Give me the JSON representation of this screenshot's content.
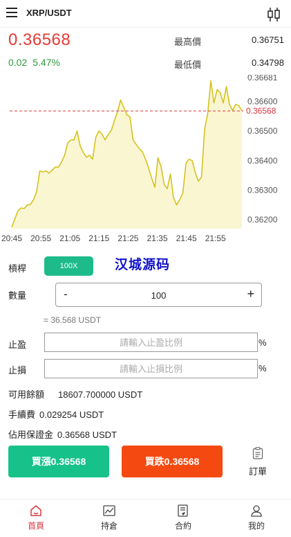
{
  "header": {
    "title": "XRP/USDT"
  },
  "price": {
    "last": "0.36568",
    "change": "0.02",
    "change_pct": "5.47%"
  },
  "high": {
    "label": "最高價",
    "value": "0.36751"
  },
  "low": {
    "label": "最低價",
    "value": "0.34798"
  },
  "chart_data": {
    "type": "area",
    "x_ticks": [
      "20:45",
      "20:55",
      "21:05",
      "21:15",
      "21:25",
      "21:35",
      "21:45",
      "21:55"
    ],
    "y_ticks": [
      "0.36681",
      "0.36600",
      "0.36500",
      "0.36400",
      "0.36300",
      "0.36200"
    ],
    "ylim": [
      0.3617,
      0.3669
    ],
    "current_price_line": {
      "value": 0.36568,
      "label": "0.36568"
    },
    "series": [
      {
        "values": [
          0.36175,
          0.36203,
          0.3623,
          0.3624,
          0.36238,
          0.3625,
          0.36252,
          0.36268,
          0.36295,
          0.36365,
          0.36362,
          0.36365,
          0.36358,
          0.36368,
          0.36378,
          0.36378,
          0.36395,
          0.36418,
          0.3646,
          0.3647,
          0.3647,
          0.365,
          0.3645,
          0.36428,
          0.36412,
          0.36418,
          0.36405,
          0.36478,
          0.365,
          0.3649,
          0.3647,
          0.36488,
          0.36502,
          0.36535,
          0.36565,
          0.36605,
          0.3658,
          0.36555,
          0.36548,
          0.3647,
          0.36455,
          0.3644,
          0.3643,
          0.36405,
          0.36375,
          0.3634,
          0.3631,
          0.3641,
          0.3638,
          0.3632,
          0.36305,
          0.36355,
          0.36275,
          0.3625,
          0.36268,
          0.3629,
          0.3639,
          0.36405,
          0.364,
          0.3636,
          0.3633,
          0.36345,
          0.36505,
          0.3656,
          0.3667,
          0.36595,
          0.3664,
          0.3663,
          0.36595,
          0.3665,
          0.3659,
          0.3657,
          0.3659,
          0.36586,
          0.36568
        ]
      }
    ],
    "grid": false
  },
  "form": {
    "leverage_label": "槓桿",
    "leverage_value": "100X",
    "watermark": "汉城源码",
    "quantity_label": "數量",
    "minus": "-",
    "quantity_value": "100",
    "plus": "+",
    "equivalent": "= 36.568 USDT",
    "take_profit_label": "止盈",
    "take_profit_placeholder": "請輸入止盈比例",
    "stop_loss_label": "止損",
    "stop_loss_placeholder": "請輸入止損比例",
    "percent": "%"
  },
  "info": {
    "available_label": "可用餘額",
    "available_value": "18607.700000 USDT",
    "fee_label": "手續費",
    "fee_value": "0.029254 USDT",
    "margin_label": "佔用保證金",
    "margin_value": "0.36568 USDT"
  },
  "actions": {
    "buy_label": "買漲0.36568",
    "sell_label": "買跌0.36568",
    "orders_label": "訂單"
  },
  "nav": {
    "home": "首頁",
    "positions": "持倉",
    "contracts": "合約",
    "profile": "我的"
  },
  "colors": {
    "up": "#2e9b3a",
    "down": "#e53935",
    "buy": "#16c28a",
    "sell": "#f44a12",
    "chart_line": "#d4c21d",
    "chart_fill": "#faf6d2"
  }
}
